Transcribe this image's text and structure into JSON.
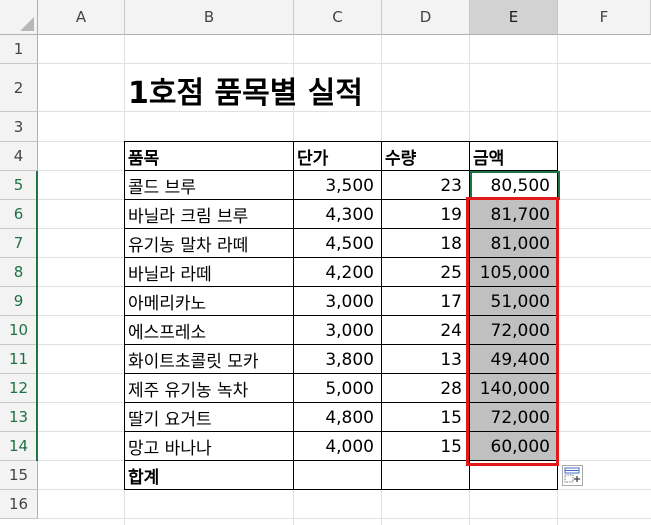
{
  "columns": [
    "A",
    "B",
    "C",
    "D",
    "E",
    "F"
  ],
  "rows": [
    "1",
    "2",
    "3",
    "4",
    "5",
    "6",
    "7",
    "8",
    "9",
    "10",
    "11",
    "12",
    "13",
    "14",
    "15",
    "16"
  ],
  "title": "1호점 품목별 실적",
  "table": {
    "headers": [
      "품목",
      "단가",
      "수량",
      "금액"
    ],
    "rows": [
      {
        "item": "콜드 브루",
        "price": "3,500",
        "qty": "23",
        "amount": "80,500"
      },
      {
        "item": "바닐라 크림 브루",
        "price": "4,300",
        "qty": "19",
        "amount": "81,700"
      },
      {
        "item": "유기농 말차 라떼",
        "price": "4,500",
        "qty": "18",
        "amount": "81,000"
      },
      {
        "item": "바닐라 라떼",
        "price": "4,200",
        "qty": "25",
        "amount": "105,000"
      },
      {
        "item": "아메리카노",
        "price": "3,000",
        "qty": "17",
        "amount": "51,000"
      },
      {
        "item": "에스프레소",
        "price": "3,000",
        "qty": "24",
        "amount": "72,000"
      },
      {
        "item": "화이트초콜릿 모카",
        "price": "3,800",
        "qty": "13",
        "amount": "49,400"
      },
      {
        "item": "제주 유기농 녹차",
        "price": "5,000",
        "qty": "28",
        "amount": "140,000"
      },
      {
        "item": "딸기 요거트",
        "price": "4,800",
        "qty": "15",
        "amount": "72,000"
      },
      {
        "item": "망고 바나나",
        "price": "4,000",
        "qty": "15",
        "amount": "60,000"
      }
    ],
    "total_label": "합계"
  },
  "colors": {
    "selection_border": "#217346",
    "highlight_box": "#e0191b",
    "selected_fill": "#c0c0c0"
  },
  "icons": {
    "quick_analysis": "quick-analysis-icon"
  }
}
